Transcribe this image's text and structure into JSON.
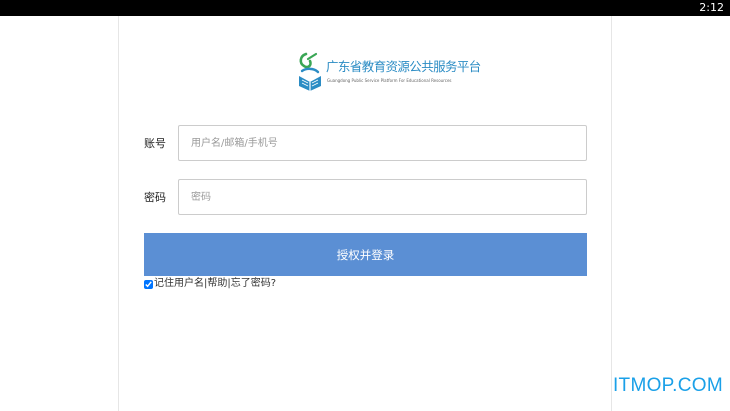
{
  "status_bar": {
    "time": "2:12"
  },
  "logo": {
    "title": "广东省教育资源公共服务平台",
    "subtitle": "Guangdong Public Service Platform For Educational Resources"
  },
  "form": {
    "account_label": "账号",
    "account_placeholder": "用户名/邮箱/手机号",
    "password_label": "密码",
    "password_placeholder": "密码",
    "submit_label": "授权并登录",
    "remember_label": "记住用户名",
    "remember_checked": true,
    "help_label": "帮助",
    "forgot_label": "忘了密码?",
    "separator": "|"
  },
  "colors": {
    "accent": "#5b8fd4",
    "logo": "#2b8cc4",
    "watermark": "#1aa0e8"
  },
  "watermark": "ITMOP.COM"
}
